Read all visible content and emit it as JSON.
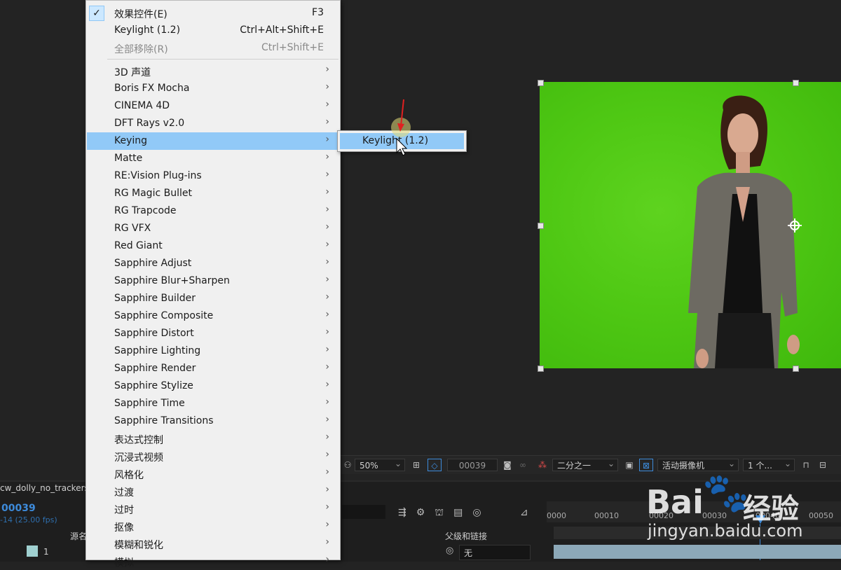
{
  "menu": {
    "top_items": [
      {
        "label": "效果控件(E)",
        "shortcut": "F3",
        "checked": true,
        "disabled": false
      },
      {
        "label": "Keylight (1.2)",
        "shortcut": "Ctrl+Alt+Shift+E",
        "checked": false,
        "disabled": false
      },
      {
        "label": "全部移除(R)",
        "shortcut": "Ctrl+Shift+E",
        "checked": false,
        "disabled": true
      }
    ],
    "categories": [
      "3D 声道",
      "Boris FX Mocha",
      "CINEMA 4D",
      "DFT Rays v2.0",
      "Keying",
      "Matte",
      "RE:Vision Plug-ins",
      "RG Magic Bullet",
      "RG Trapcode",
      "RG VFX",
      "Red Giant",
      "Sapphire Adjust",
      "Sapphire Blur+Sharpen",
      "Sapphire Builder",
      "Sapphire Composite",
      "Sapphire Distort",
      "Sapphire Lighting",
      "Sapphire Render",
      "Sapphire Stylize",
      "Sapphire Time",
      "Sapphire Transitions",
      "表达式控制",
      "沉浸式视频",
      "风格化",
      "过渡",
      "过时",
      "抠像",
      "模糊和锐化",
      "模拟"
    ],
    "highlighted": "Keying",
    "submenu_item": "Keylight (1.2)"
  },
  "viewer_bar": {
    "zoom": "50%",
    "timecode": "00039",
    "resolution": "二分之一",
    "camera": "活动摄像机",
    "views": "1 个..."
  },
  "timeline": {
    "comp_tab": "cw_dolly_no_trackers",
    "current_time": "00039",
    "fps": "-14 (25.00 fps)",
    "col_source": "源名",
    "col_parent": "父级和链接",
    "layer_index": "1",
    "parent_value": "无",
    "ruler_ticks": [
      "0000",
      "00010",
      "00020",
      "00030",
      "00040",
      "00050"
    ]
  },
  "watermark": {
    "brand": "Bai",
    "brand_cn": "经验",
    "url": "jingyan.baidu.com"
  },
  "colors": {
    "menu_highlight": "#91c9f7",
    "green_screen": "#4fc814",
    "timecode_blue": "#3d8bdb",
    "pointer_arrow": "#e02020"
  }
}
